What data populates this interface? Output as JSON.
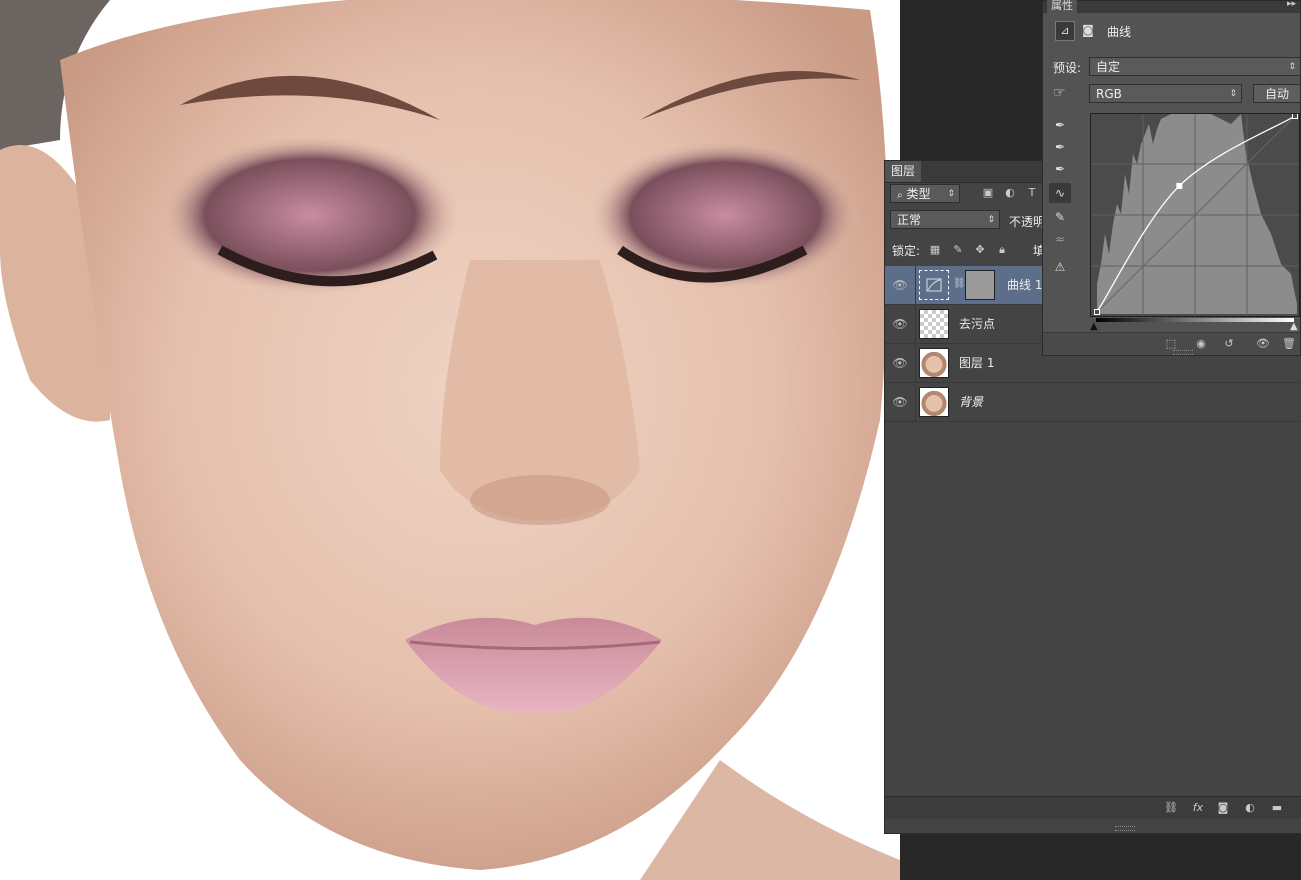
{
  "canvas": {
    "description": ""
  },
  "layers_panel": {
    "tab": "图层",
    "filter_type": "类型",
    "blend_mode": "正常",
    "opacity_label": "不透明",
    "lock_label": "锁定:",
    "fill_label": "填",
    "layers": [
      {
        "name": "曲线 1",
        "kind": "adjustment",
        "selected": true
      },
      {
        "name": "去污点",
        "kind": "transparent",
        "selected": false
      },
      {
        "name": "图层 1",
        "kind": "photo",
        "selected": false
      },
      {
        "name": "背景",
        "kind": "photo",
        "selected": false
      }
    ]
  },
  "properties_panel": {
    "tab": "属性",
    "title": "曲线",
    "preset_label": "预设:",
    "preset_value": "自定",
    "channel_value": "RGB",
    "auto_button": "自动"
  },
  "curve": {
    "points": [
      [
        0,
        0
      ],
      [
        106,
        164
      ],
      [
        255,
        255
      ]
    ]
  }
}
